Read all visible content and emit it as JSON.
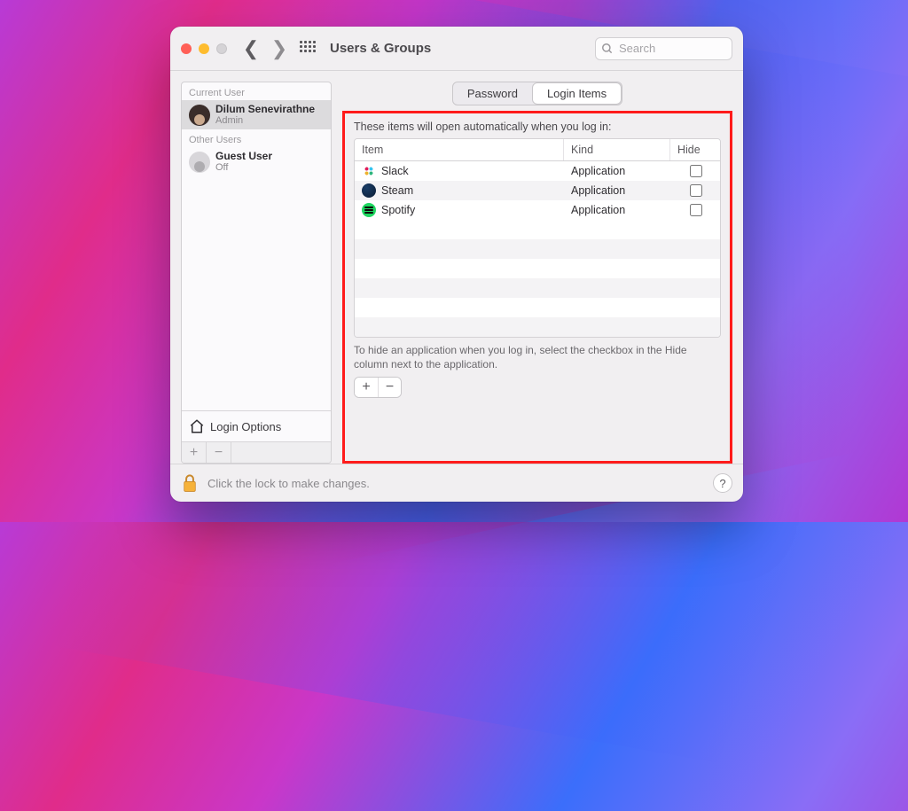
{
  "window": {
    "title": "Users & Groups"
  },
  "search": {
    "placeholder": "Search",
    "value": ""
  },
  "sidebar": {
    "headings": {
      "current": "Current User",
      "other": "Other Users"
    },
    "current": {
      "name": "Dilum Senevirathne",
      "role": "Admin"
    },
    "others": [
      {
        "name": "Guest User",
        "role": "Off"
      }
    ],
    "login_options_label": "Login Options"
  },
  "tabs": {
    "password": "Password",
    "login_items": "Login Items",
    "active": "login_items"
  },
  "login_items": {
    "header_hint": "These items will open automatically when you log in:",
    "columns": {
      "item": "Item",
      "kind": "Kind",
      "hide": "Hide"
    },
    "rows": [
      {
        "icon": "slack",
        "name": "Slack",
        "kind": "Application",
        "hide": false
      },
      {
        "icon": "steam",
        "name": "Steam",
        "kind": "Application",
        "hide": false
      },
      {
        "icon": "spotify",
        "name": "Spotify",
        "kind": "Application",
        "hide": false
      }
    ],
    "footer_hint": "To hide an application when you log in, select the checkbox in the Hide column next to the application."
  },
  "lockbar": {
    "text": "Click the lock to make changes."
  }
}
